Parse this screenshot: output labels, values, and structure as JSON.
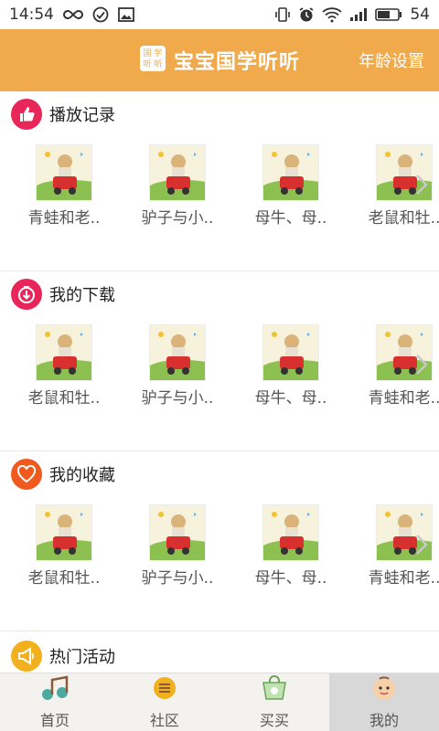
{
  "status_bar": {
    "time": "14:54",
    "battery": "54",
    "icons_left": [
      "infinity-icon",
      "check-circle-icon",
      "image-icon"
    ],
    "icons_right": [
      "vibrate-icon",
      "alarm-icon",
      "wifi-icon",
      "signal-icon",
      "battery-icon"
    ]
  },
  "header": {
    "title": "宝宝国学听听",
    "logo_text_top": "国 学",
    "logo_text_bottom": "听 听",
    "age_setting": "年龄设置",
    "background": "#F0A94B"
  },
  "sections": [
    {
      "title": "播放记录",
      "icon": "thumbs-up-icon",
      "color": "#E8265A",
      "items": [
        "青蛙和老..",
        "驴子与小..",
        "母牛、母..",
        "老鼠和牡.."
      ]
    },
    {
      "title": "我的下载",
      "icon": "download-icon",
      "color": "#E8265A",
      "items": [
        "老鼠和牡..",
        "驴子与小..",
        "母牛、母..",
        "青蛙和老.."
      ]
    },
    {
      "title": "我的收藏",
      "icon": "heart-icon",
      "color": "#F05A1E",
      "items": [
        "老鼠和牡..",
        "驴子与小..",
        "母牛、母..",
        "青蛙和老.."
      ]
    }
  ],
  "hot": {
    "title": "热门活动",
    "icon": "megaphone-icon",
    "color": "#F2B01E"
  },
  "tabs": [
    {
      "label": "首页",
      "icon": "music-note-icon",
      "active": false
    },
    {
      "label": "社区",
      "icon": "list-icon",
      "active": false
    },
    {
      "label": "买买",
      "icon": "shopping-bag-icon",
      "active": false
    },
    {
      "label": "我的",
      "icon": "baby-face-icon",
      "active": true
    }
  ]
}
